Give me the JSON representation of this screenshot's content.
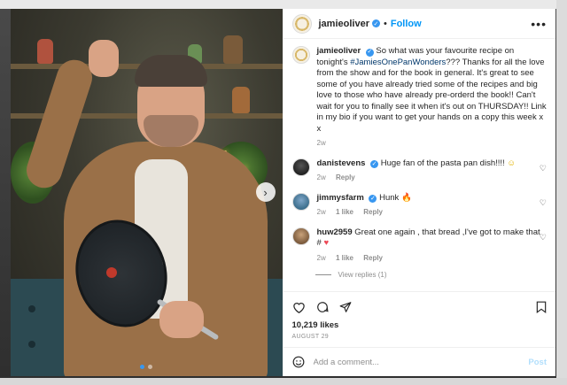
{
  "post": {
    "username": "jamieoliver",
    "follow_label": "Follow",
    "more_label": "•••",
    "caption_before": "So what was your favourite recipe on tonight's",
    "caption_hashtag": "#JamiesOnePanWonders",
    "caption_after": "??? Thanks for all the love from the show and for the book in general. It's great to see some of you have already tried some of the recipes and big love to those who have already pre-orderd the book!! Can't wait for you to finally see it when it's out on THURSDAY!! Link in my bio if you want to get your hands on a copy this week x x",
    "caption_time": "2w"
  },
  "comments": [
    {
      "username": "danistevens",
      "verified": true,
      "text": "Huge fan of the pasta pan dish!!!!",
      "emoji": "☺",
      "time": "2w",
      "reply": "Reply",
      "likes": ""
    },
    {
      "username": "jimmysfarm",
      "verified": true,
      "text": "Hunk",
      "emoji": "🔥",
      "time": "2w",
      "reply": "Reply",
      "likes": "1 like"
    },
    {
      "username": "huw2959",
      "verified": false,
      "text": "Great one again , that bread ,I've got to make that #",
      "emoji": "♥",
      "time": "2w",
      "reply": "Reply",
      "likes": "1 like"
    }
  ],
  "view_replies": "View replies (1)",
  "actions": {
    "likes": "10,219 likes",
    "date": "AUGUST 29"
  },
  "add_comment": {
    "placeholder": "Add a comment...",
    "post_label": "Post"
  },
  "photo": {
    "next_label": "›",
    "slide_count": 2,
    "active_slide": 1
  },
  "colors": {
    "accent": "#0095f6",
    "verified": "#3897f0",
    "hashtag": "#00376b"
  }
}
